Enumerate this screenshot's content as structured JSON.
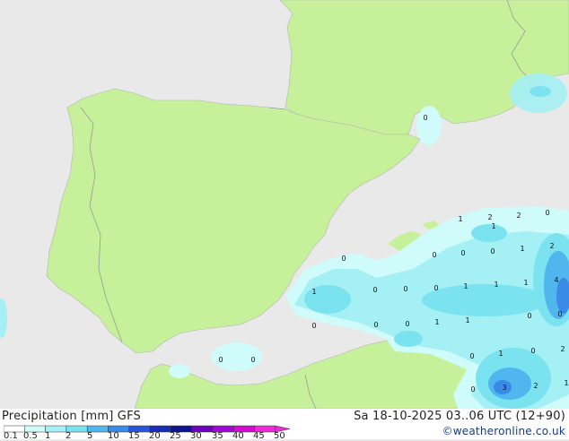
{
  "footer": {
    "title": "Precipitation [mm]  GFS",
    "validity": "Sa 18-10-2025 03..06 UTC (12+90)",
    "copyright": "©weatheronline.co.uk"
  },
  "legend": {
    "ticks": [
      "0.1",
      "0.5",
      "1",
      "2",
      "5",
      "10",
      "15",
      "20",
      "25",
      "30",
      "35",
      "40",
      "45",
      "50"
    ],
    "colors": [
      "#ffffff",
      "#cffbfb",
      "#a4f0f4",
      "#7ae3ef",
      "#4fb6ee",
      "#3a8ae8",
      "#2a55d6",
      "#1b2cb5",
      "#0f138f",
      "#6d06b8",
      "#9f08d6",
      "#cf0ccf",
      "#ee2ad6"
    ]
  },
  "colors": {
    "land": "#c6f19a",
    "sea": "#e9e9e9",
    "border": "#9a9a9a"
  },
  "map_labels": [
    "0",
    "1",
    "2",
    "2",
    "0",
    "0",
    "0",
    "0",
    "1",
    "2",
    "0",
    "1",
    "1",
    "0",
    "0",
    "0",
    "1",
    "1",
    "1",
    "4",
    "0",
    "0",
    "0",
    "1",
    "1",
    "0",
    "0",
    "0",
    "0",
    "1",
    "0",
    "2",
    "3",
    "2",
    "1",
    "0",
    "0"
  ]
}
